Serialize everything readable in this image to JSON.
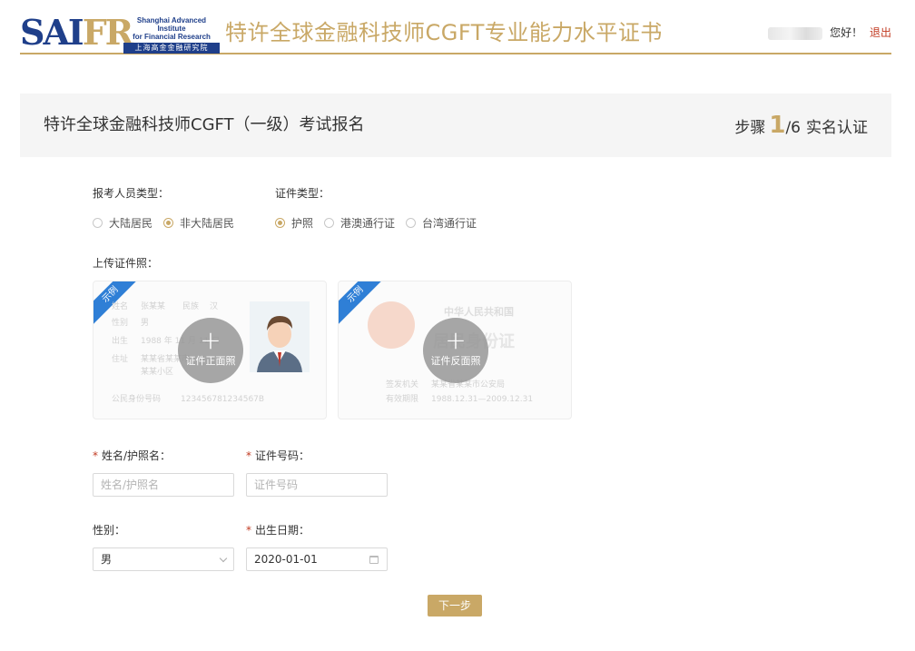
{
  "header": {
    "logo_mark": "SAIFR",
    "logo_en_line1": "Shanghai Advanced Institute",
    "logo_en_line2": "for Financial Research",
    "logo_cn": "上海高金金融研究院",
    "site_title": "特许全球金融科技师CGFT专业能力水平证书",
    "greeting": "您好！",
    "logout": "退出"
  },
  "banner": {
    "title": "特许全球金融科技师CGFT（一级）考试报名",
    "step_prefix": "步骤",
    "step_current": "1",
    "step_total": "/6",
    "step_name": "实名认证"
  },
  "form": {
    "applicant_type": {
      "label": "报考人员类型：",
      "options": [
        "大陆居民",
        "非大陆居民"
      ],
      "selected": "非大陆居民"
    },
    "id_type": {
      "label": "证件类型：",
      "options": [
        "护照",
        "港澳通行证",
        "台湾通行证"
      ],
      "selected": "护照"
    },
    "upload": {
      "label": "上传证件照：",
      "sample_tag": "示例",
      "front_button": "证件正面照",
      "back_button": "证件反面照",
      "front_sample": {
        "name_label": "姓名",
        "name_value": "张某某",
        "ethnic_label": "民族",
        "ethnic_value": "汉",
        "sex_label": "性别",
        "sex_value": "男",
        "birth_label": "出生",
        "birth_value": "1988 年 11 月 11 日",
        "address_label": "住址",
        "address_line1": "某某省某某市",
        "address_line2": "某某小区",
        "id_label": "公民身份号码",
        "id_value": "123456781234567B"
      },
      "back_sample": {
        "country": "中华人民共和国",
        "card_title": "居民身份证",
        "authority_label": "签发机关",
        "authority_value": "某某省某某市公安局",
        "valid_label": "有效期限",
        "valid_value": "1988.12.31—2009.12.31"
      }
    },
    "name": {
      "label": "姓名/护照名：",
      "placeholder": "姓名/护照名",
      "value": ""
    },
    "id_number": {
      "label": "证件号码：",
      "placeholder": "证件号码",
      "value": ""
    },
    "gender": {
      "label": "性别：",
      "value": "男"
    },
    "birth_date": {
      "label": "出生日期：",
      "value": "2020-01-01"
    },
    "next_button": "下一步"
  },
  "colors": {
    "brand_gold": "#c9a866",
    "brand_blue": "#1f3f8a",
    "required_red": "#c23b22",
    "sample_tag_blue": "#2f7fd6"
  }
}
